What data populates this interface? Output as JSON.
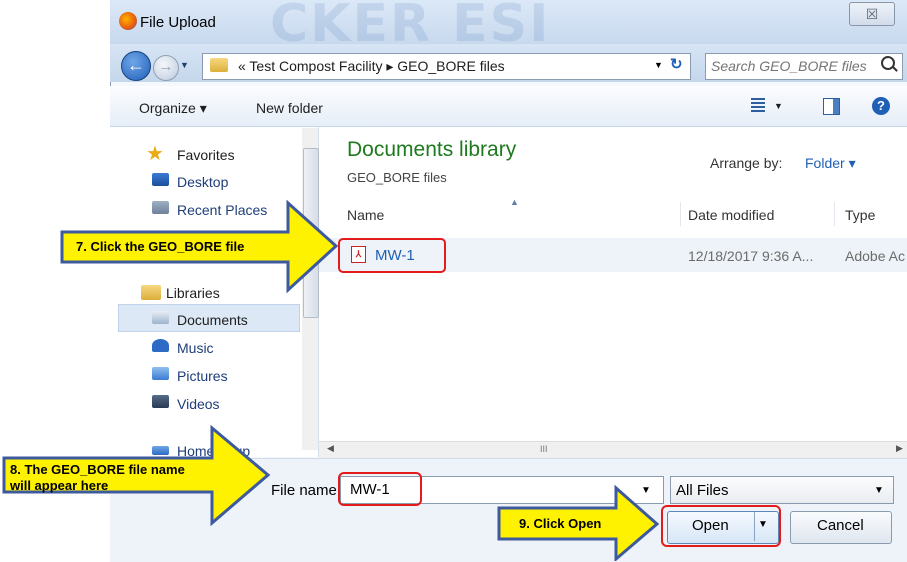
{
  "window": {
    "title": "File Upload",
    "close_glyph": "☒",
    "watermark": "CKER ESI"
  },
  "address": {
    "back_glyph": "←",
    "forward_glyph": "→",
    "breadcrumb": "« Test Compost Facility ▸ GEO_BORE files",
    "search_placeholder": "Search GEO_BORE files"
  },
  "toolbar": {
    "organize_label": "Organize ▾",
    "new_folder_label": "New folder",
    "help_glyph": "?"
  },
  "sidebar": {
    "favorites_label": "Favorites",
    "items": [
      {
        "label": "Desktop",
        "icon": "desktop-icon"
      },
      {
        "label": "Recent Places",
        "icon": "recent-places-icon"
      }
    ],
    "libraries_label": "Libraries",
    "library_items": [
      {
        "label": "Documents",
        "icon": "documents-icon"
      },
      {
        "label": "Music",
        "icon": "music-icon"
      },
      {
        "label": "Pictures",
        "icon": "pictures-icon"
      },
      {
        "label": "Videos",
        "icon": "videos-icon"
      }
    ],
    "partial_item": "Homegroup"
  },
  "content": {
    "library_title": "Documents library",
    "library_subtitle": "GEO_BORE files",
    "arrange_label": "Arrange by:",
    "arrange_value": "Folder ▾",
    "columns": [
      "Name",
      "Date modified",
      "Type"
    ],
    "files": [
      {
        "name": "MW-1",
        "date": "12/18/2017 9:36 A...",
        "type": "Adobe Ac"
      }
    ],
    "scroll_grip": "III"
  },
  "bottom": {
    "file_name_label": "File name:",
    "file_name_value": "MW-1",
    "file_type_value": "All Files",
    "open_label": "Open",
    "cancel_label": "Cancel"
  },
  "callouts": {
    "step7": "7. Click the GEO_BORE file",
    "step8_line1": "8. The GEO_BORE file name",
    "step8_line2": "will appear here",
    "step9": "9. Click Open"
  },
  "colors": {
    "highlight": "#e41b1b",
    "callout_fill": "#fff200",
    "callout_stroke": "#3d5a9e",
    "library_title": "#1e7a1e",
    "link_blue": "#1f5fb6"
  }
}
